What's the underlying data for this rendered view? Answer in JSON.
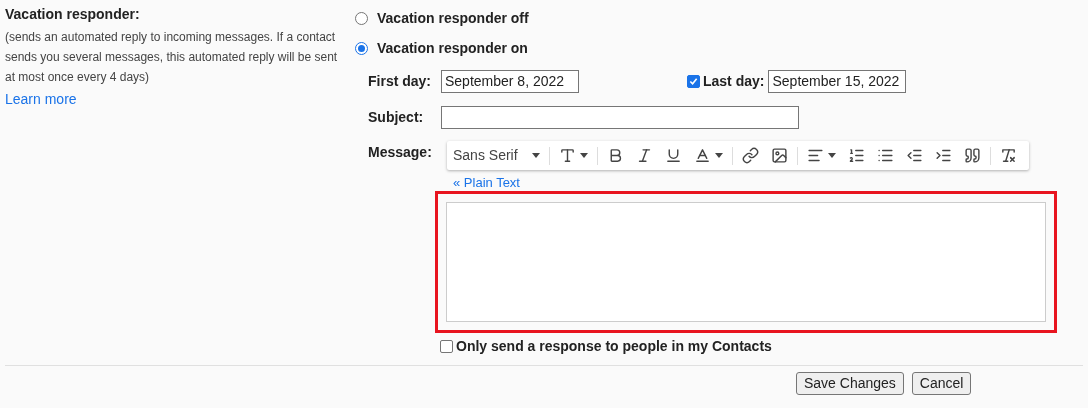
{
  "setting": {
    "title": "Vacation responder:",
    "description": "(sends an automated reply to incoming messages. If a contact sends you several messages, this automated reply will be sent at most once every 4 days)",
    "link": "Learn more"
  },
  "options": [
    {
      "label": "Vacation responder off",
      "selected": false
    },
    {
      "label": "Vacation responder on",
      "selected": true
    }
  ],
  "first_day": {
    "label": "First day:",
    "value": "September 8, 2022"
  },
  "last_day": {
    "label": "Last day:",
    "value": "September 15, 2022",
    "checked": true
  },
  "subject": {
    "label": "Subject:"
  },
  "message": {
    "label": "Message:",
    "plain_text_link": "« Plain Text",
    "highlighted": true
  },
  "toolbar": {
    "font": "Sans Serif",
    "tools": [
      {
        "kind": "text-size",
        "dropdown": true
      },
      {
        "kind": "bold",
        "dropdown": false
      },
      {
        "kind": "italic",
        "dropdown": false
      },
      {
        "kind": "underline",
        "dropdown": false
      },
      {
        "kind": "text-color",
        "dropdown": true
      },
      {
        "kind": "link",
        "dropdown": false
      },
      {
        "kind": "image",
        "dropdown": false
      },
      {
        "kind": "align",
        "dropdown": true
      },
      {
        "kind": "numbered-list",
        "dropdown": false
      },
      {
        "kind": "bulleted-list",
        "dropdown": false
      },
      {
        "kind": "indent-less",
        "dropdown": false
      },
      {
        "kind": "indent-more",
        "dropdown": false
      },
      {
        "kind": "quote",
        "dropdown": false
      },
      {
        "kind": "remove-formatting",
        "dropdown": false
      }
    ]
  },
  "contacts_only": {
    "label": "Only send a response to people in my Contacts",
    "checked": false
  },
  "buttons": [
    "Save Changes",
    "Cancel"
  ]
}
